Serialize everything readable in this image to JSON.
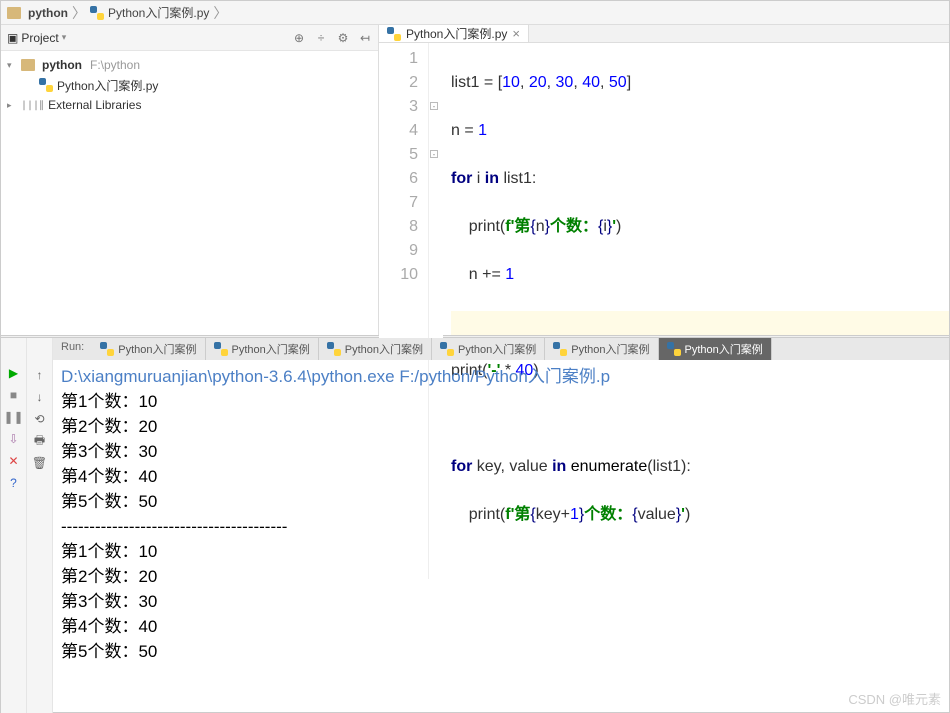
{
  "breadcrumb": {
    "folder": "python",
    "file": "Python入门案例.py"
  },
  "sidebar": {
    "title": "Project",
    "root": {
      "name": "python",
      "path": "F:\\python"
    },
    "file": "Python入门案例.py",
    "external": "External Libraries"
  },
  "tab": {
    "name": "Python入门案例.py"
  },
  "code": {
    "lines": [
      "1",
      "2",
      "3",
      "4",
      "5",
      "6",
      "7",
      "8",
      "9",
      "10"
    ]
  },
  "run": {
    "label": "Run:",
    "tabs": [
      "Python入门案例",
      "Python入门案例",
      "Python入门案例",
      "Python入门案例",
      "Python入门案例",
      "Python入门案例"
    ],
    "cmd": "D:\\xiangmuruanjian\\python-3.6.4\\python.exe F:/python/Python入门案例.p",
    "output": [
      "第1个数：10",
      "第2个数：20",
      "第3个数：30",
      "第4个数：40",
      "第5个数：50",
      "----------------------------------------",
      "第1个数：10",
      "第2个数：20",
      "第3个数：30",
      "第4个数：40",
      "第5个数：50"
    ]
  },
  "watermark": "CSDN @唯元素"
}
